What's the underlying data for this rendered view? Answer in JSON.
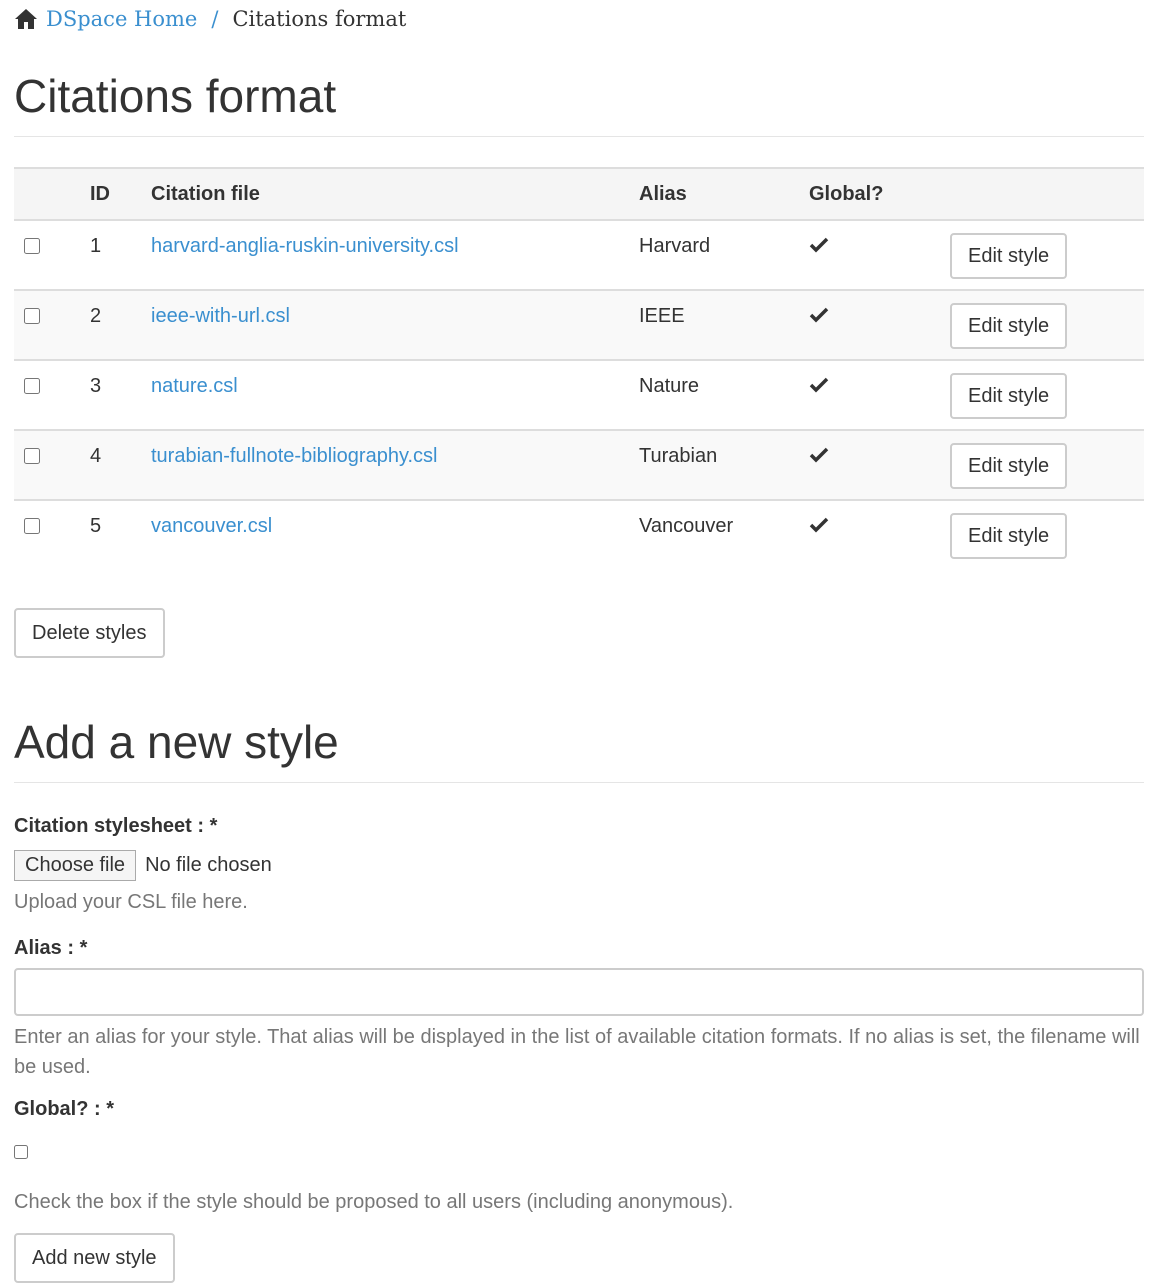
{
  "breadcrumb": {
    "home": "DSpace Home",
    "separator": "/",
    "current": "Citations format"
  },
  "page_title": "Citations format",
  "table": {
    "headers": {
      "id": "ID",
      "file": "Citation file",
      "alias": "Alias",
      "global": "Global?"
    },
    "rows": [
      {
        "id": "1",
        "file": "harvard-anglia-ruskin-university.csl",
        "alias": "Harvard",
        "global": true,
        "action": "Edit style"
      },
      {
        "id": "2",
        "file": "ieee-with-url.csl",
        "alias": "IEEE",
        "global": true,
        "action": "Edit style"
      },
      {
        "id": "3",
        "file": "nature.csl",
        "alias": "Nature",
        "global": true,
        "action": "Edit style"
      },
      {
        "id": "4",
        "file": "turabian-fullnote-bibliography.csl",
        "alias": "Turabian",
        "global": true,
        "action": "Edit style"
      },
      {
        "id": "5",
        "file": "vancouver.csl",
        "alias": "Vancouver",
        "global": true,
        "action": "Edit style"
      }
    ]
  },
  "delete_button": "Delete styles",
  "add_section": {
    "title": "Add a new style",
    "stylesheet_label": "Citation stylesheet : *",
    "choose_file": "Choose file",
    "no_file": "No file chosen",
    "stylesheet_help": "Upload your CSL file here.",
    "alias_label": "Alias : *",
    "alias_value": "",
    "alias_help": "Enter an alias for your style. That alias will be displayed in the list of available citation formats. If no alias is set, the filename will be used.",
    "global_label": "Global? : *",
    "global_checked": false,
    "global_help": "Check the box if the style should be proposed to all users (including anonymous).",
    "submit": "Add new style"
  },
  "colors": {
    "link": "#3a8fcf",
    "text": "#333333",
    "muted": "#777777",
    "border": "#dddddd"
  },
  "icons": {
    "home": "home-icon",
    "check": "check-icon"
  }
}
